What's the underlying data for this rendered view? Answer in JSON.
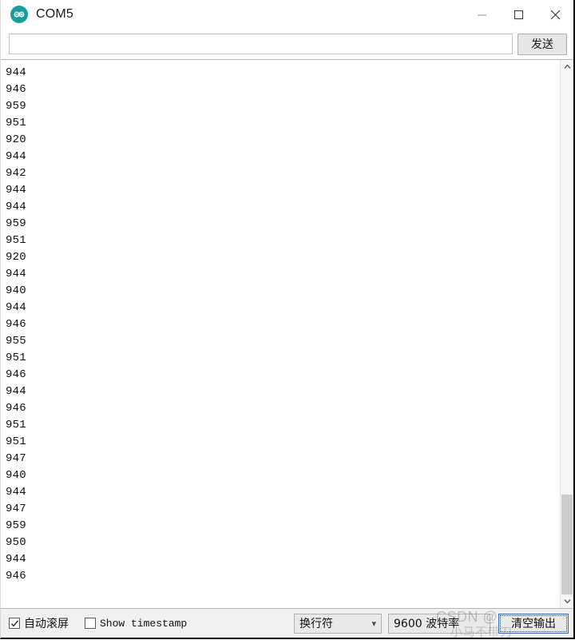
{
  "window": {
    "title": "COM5",
    "app_icon": "arduino-infinity-icon",
    "controls": {
      "minimize": "minimize-icon",
      "maximize": "maximize-icon",
      "close": "close-icon"
    }
  },
  "send_row": {
    "input_value": "",
    "input_placeholder": "",
    "send_label": "发送"
  },
  "console": {
    "lines": [
      "944",
      "946",
      "959",
      "951",
      "920",
      "944",
      "942",
      "944",
      "944",
      "959",
      "951",
      "920",
      "944",
      "940",
      "944",
      "946",
      "955",
      "951",
      "946",
      "944",
      "946",
      "951",
      "951",
      "947",
      "940",
      "944",
      "947",
      "959",
      "950",
      "944",
      "946"
    ]
  },
  "scrollbar": {
    "up_arrow": "chevron-up-icon",
    "down_arrow": "chevron-down-icon"
  },
  "statusbar": {
    "autoscroll_label": "自动滚屏",
    "autoscroll_checked": true,
    "timestamp_label": "Show timestamp",
    "timestamp_checked": false,
    "newline_value": "换行符",
    "baud_value": "9600 波特率",
    "clear_label": "清空输出"
  },
  "watermark": {
    "line1": "CSDN @",
    "line2": "小马不带刀"
  },
  "colors": {
    "accent": "#1a9c9c",
    "focus_border": "#2a6fc4",
    "statusbar_bg": "#f0f0f0",
    "console_text": "#111111"
  }
}
